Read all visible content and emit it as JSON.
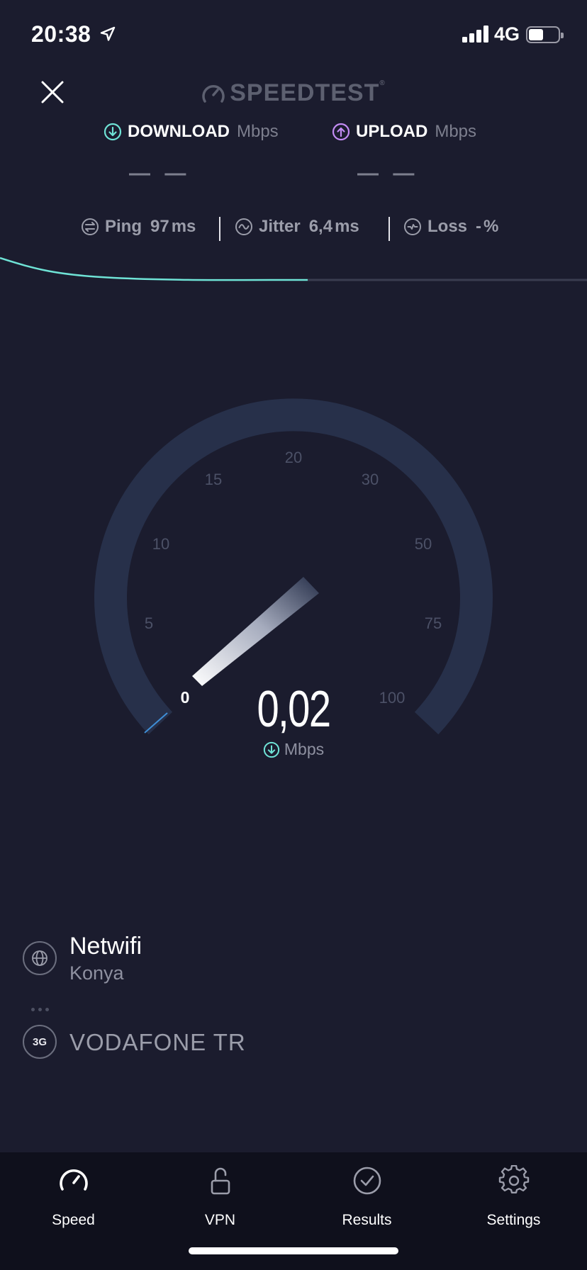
{
  "status_bar": {
    "time": "20:38",
    "network": "4G"
  },
  "header": {
    "brand": "SPEEDTEST",
    "trademark": "®"
  },
  "download": {
    "label": "DOWNLOAD",
    "unit": "Mbps",
    "value": "— —"
  },
  "upload": {
    "label": "UPLOAD",
    "unit": "Mbps",
    "value": "— —"
  },
  "stats": {
    "ping": {
      "label": "Ping",
      "value": "97",
      "unit": "ms"
    },
    "jitter": {
      "label": "Jitter",
      "value": "6,4",
      "unit": "ms"
    },
    "loss": {
      "label": "Loss",
      "value": "-",
      "unit": "%"
    }
  },
  "gauge": {
    "ticks": [
      "0",
      "5",
      "10",
      "15",
      "20",
      "30",
      "50",
      "75",
      "100"
    ],
    "current_value": "0,02",
    "unit": "Mbps"
  },
  "provider": {
    "name": "Netwifi",
    "city": "Konya"
  },
  "carrier": {
    "badge": "3G",
    "name": "VODAFONE TR"
  },
  "tabs": [
    {
      "label": "Speed"
    },
    {
      "label": "VPN"
    },
    {
      "label": "Results"
    },
    {
      "label": "Settings"
    }
  ],
  "colors": {
    "background": "#1b1c2e",
    "accent_download": "#6fe3d6",
    "accent_upload": "#c38cf4",
    "gauge_track": "#27304a",
    "tab_bar": "#0f101c"
  }
}
